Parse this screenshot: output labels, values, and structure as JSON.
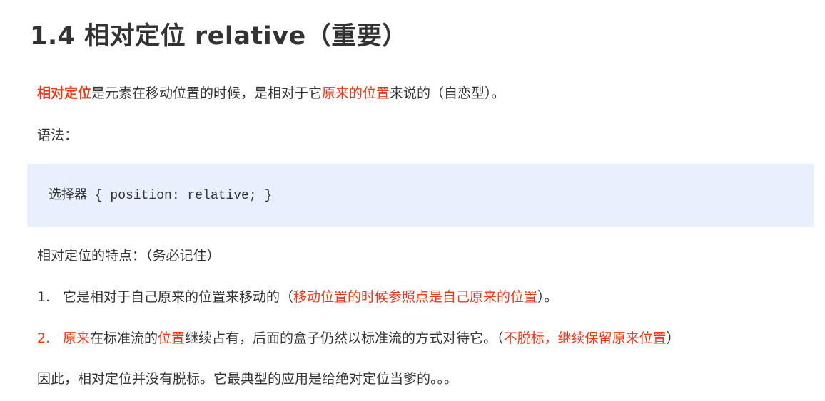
{
  "heading": "1.4 相对定位 relative（重要）",
  "intro": {
    "term": "相对定位",
    "text1": "是元素在移动位置的时候，是相对于它",
    "highlight": "原来的位置",
    "text2": "来说的（自恋型）。"
  },
  "syntax_label": "语法：",
  "code": {
    "selector": "选择器",
    "rule": " { position: relative; }"
  },
  "features_label": "相对定位的特点：（务必记住）",
  "point1": {
    "num": "1.",
    "text": "它是相对于自己原来的位置来移动的（",
    "highlight": "移动位置的时候参照点是自己原来的位置",
    "end": "）。"
  },
  "point2": {
    "num": "2.",
    "h1": "原来",
    "t1": "在标准流的",
    "h2": "位置",
    "t2": "继续占有，后面的盒子仍然以标准流的方式对待它。（",
    "h3": "不脱标，继续保留原来位置",
    "end": "）"
  },
  "conclusion": "因此，相对定位并没有脱标。它最典型的应用是给绝对定位当爹的。。。",
  "colors": {
    "text": "#333333",
    "accent_red": "#e8391d",
    "code_background": "#e8f0fd"
  }
}
